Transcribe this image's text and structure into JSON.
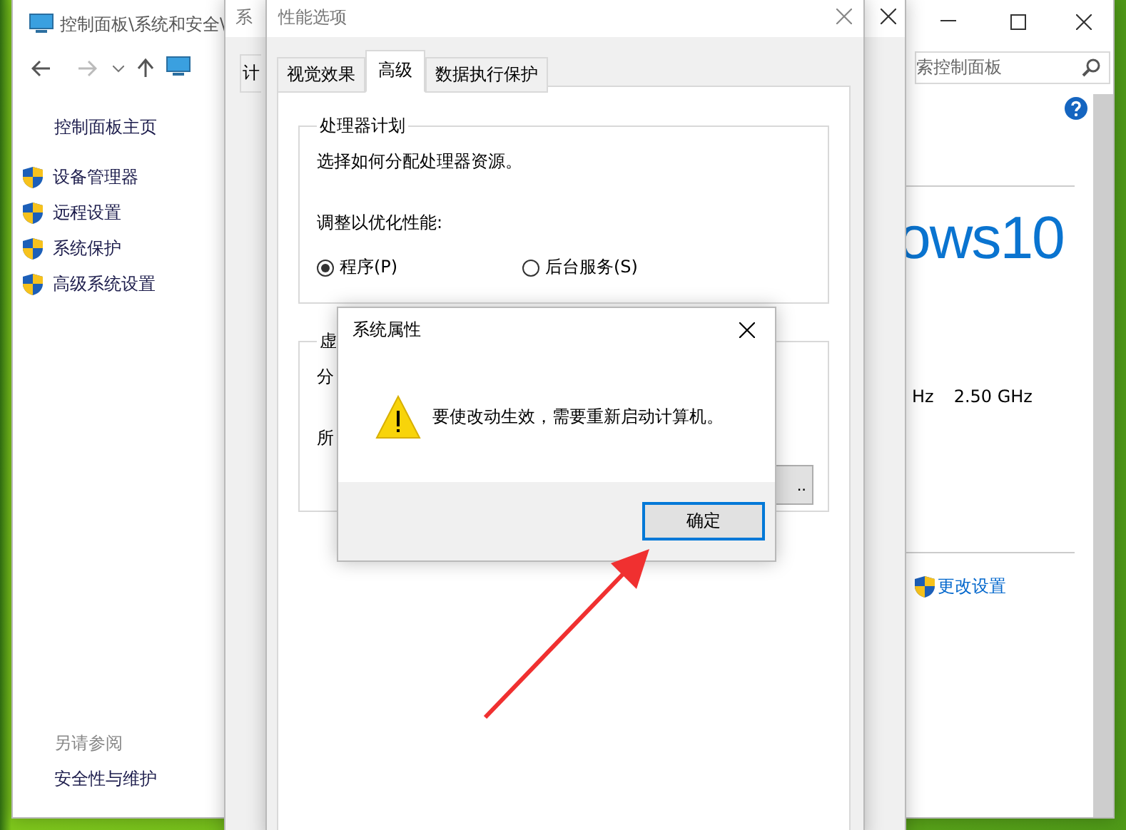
{
  "control_panel": {
    "title": "控制面板\\系统和安全\\",
    "search": {
      "placeholder": "索控制面板"
    },
    "sidebar": {
      "home": "控制面板主页",
      "items": [
        {
          "label": "设备管理器"
        },
        {
          "label": "远程设置"
        },
        {
          "label": "系统保护"
        },
        {
          "label": "高级系统设置"
        }
      ],
      "see_also": "另请参阅",
      "links": [
        "安全性与维护"
      ]
    },
    "content": {
      "logo_text": "ows10",
      "speed_1": "Hz",
      "speed_2": "2.50 GHz",
      "change_settings": "更改设置"
    }
  },
  "system_properties": {
    "title": "系",
    "tab": "计"
  },
  "performance_options": {
    "title": "性能选项",
    "tabs": [
      {
        "label": "视觉效果",
        "selected": false
      },
      {
        "label": "高级",
        "selected": true
      },
      {
        "label": "数据执行保护",
        "selected": false
      }
    ],
    "processor_group": {
      "title": "处理器计划",
      "description": "选择如何分配处理器资源。",
      "prompt": "调整以优化性能:",
      "options": [
        {
          "label": "程序(P)",
          "selected": true
        },
        {
          "label": "后台服务(S)",
          "selected": false
        }
      ]
    },
    "memory_group": {
      "title": "虚",
      "line_1": "分",
      "line_2": "所",
      "button": ".."
    }
  },
  "alert": {
    "title": "系统属性",
    "message": "要使改动生效，需要重新启动计算机。",
    "button": "确定"
  }
}
